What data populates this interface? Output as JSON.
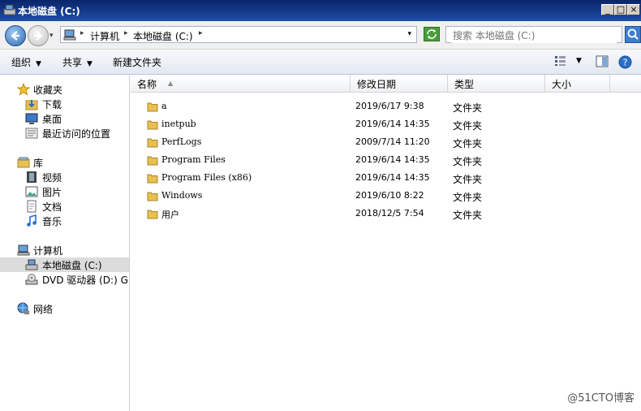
{
  "window": {
    "title": "本地磁盘 (C:)",
    "controls": {
      "minimize": "_",
      "maximize": "□",
      "close": "×"
    }
  },
  "address": {
    "history_arrow": "▾",
    "breadcrumb": [
      "计算机",
      "本地磁盘 (C:)"
    ],
    "separator": "▸",
    "dropdown_arrow": "▾"
  },
  "search": {
    "placeholder": "搜索 本地磁盘 (C:)"
  },
  "toolbar": {
    "organize": "组织",
    "share": "共享",
    "new_folder": "新建文件夹",
    "dropdown_arrow": "▼"
  },
  "nav": {
    "favorites": {
      "label": "收藏夹",
      "items": [
        "下载",
        "桌面",
        "最近访问的位置"
      ]
    },
    "libraries": {
      "label": "库",
      "items": [
        "视频",
        "图片",
        "文档",
        "音乐"
      ]
    },
    "computer": {
      "label": "计算机",
      "items": [
        "本地磁盘 (C:)",
        "DVD 驱动器 (D:) GR"
      ]
    },
    "network": {
      "label": "网络"
    }
  },
  "columns": {
    "name": "名称",
    "date": "修改日期",
    "type": "类型",
    "size": "大小"
  },
  "files": [
    {
      "name": "a",
      "date": "2019/6/17 9:38",
      "type": "文件夹"
    },
    {
      "name": "inetpub",
      "date": "2019/6/14 14:35",
      "type": "文件夹"
    },
    {
      "name": "PerfLogs",
      "date": "2009/7/14 11:20",
      "type": "文件夹"
    },
    {
      "name": "Program Files",
      "date": "2019/6/14 14:35",
      "type": "文件夹"
    },
    {
      "name": "Program Files (x86)",
      "date": "2019/6/14 14:35",
      "type": "文件夹"
    },
    {
      "name": "Windows",
      "date": "2019/6/10 8:22",
      "type": "文件夹"
    },
    {
      "name": "用户",
      "date": "2018/12/5 7:54",
      "type": "文件夹"
    }
  ],
  "watermark": "@51CTO博客",
  "colors": {
    "titlebar": "#0a246a",
    "selected_bg": "#dcdcdc",
    "folder": "#e8c050"
  }
}
